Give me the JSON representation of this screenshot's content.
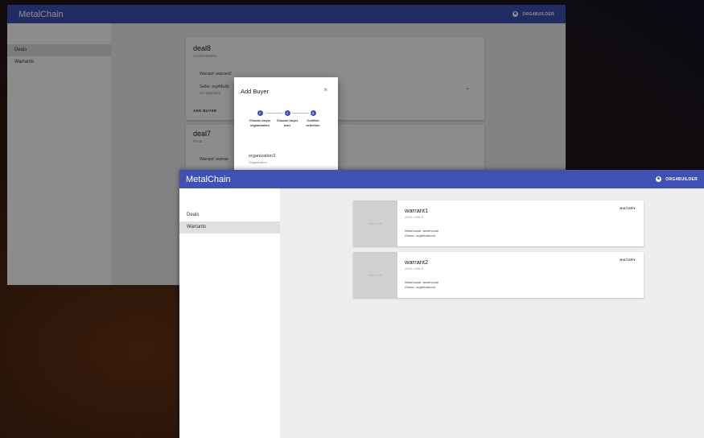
{
  "back": {
    "app_title": "MetalChain",
    "user": "ORG4BUILDER",
    "sidebar": [
      "Deals",
      "Warrants"
    ],
    "deals": [
      {
        "name": "deal8",
        "status": "CONFIRMED",
        "warrant": "Warrant: warrant2",
        "seller": "Seller: org4Build",
        "approved": "1/1 approved",
        "button": "ADD BUYER"
      },
      {
        "name": "deal7",
        "status": "PAID",
        "warrant": "Warrant: warran"
      }
    ],
    "dialog": {
      "title": "Add Buyer",
      "close": "×",
      "steps": [
        {
          "icon": "✓",
          "label": "Choose buyer organization"
        },
        {
          "icon": "✓",
          "label": "Choose buyer user"
        },
        {
          "icon": "3",
          "label": "Confirm selection"
        }
      ],
      "option_name": "organization3",
      "option_type": "Organization"
    }
  },
  "front": {
    "app_title": "MetalChain",
    "user": "ORG4BUILDER",
    "sidebar": [
      "Deals",
      "Warrants"
    ],
    "warrants": [
      {
        "thumb": "150 x 150",
        "name": "warrant1",
        "status": "AVAILABLE",
        "warehouse": "Warehouse: warehouse",
        "owner": "Owner: organization4",
        "history": "HISTORY"
      },
      {
        "thumb": "150 x 150",
        "name": "warrant2",
        "status": "AVAILABLE",
        "warehouse": "Warehouse: warehouse",
        "owner": "Owner: organization4",
        "history": "HISTORY"
      }
    ]
  },
  "colors": {
    "appbar": "#3f51b5",
    "background": "#eeeeee"
  },
  "icons": [
    "account-circle-icon",
    "close-icon",
    "check-icon",
    "chevron-down-icon"
  ]
}
